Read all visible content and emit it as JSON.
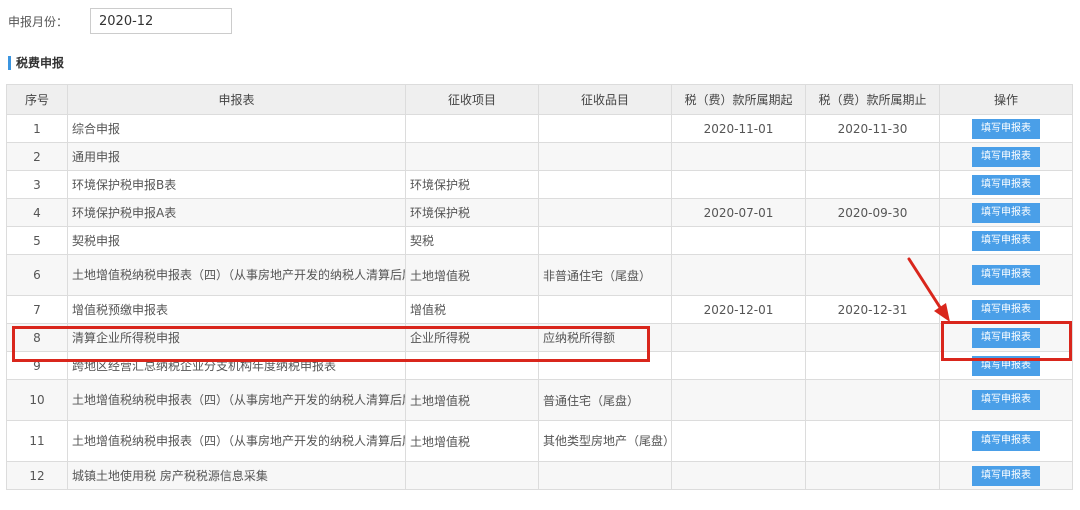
{
  "period": {
    "label": "申报月份：",
    "value": "2020-12"
  },
  "section_title": "税费申报",
  "table": {
    "headers": [
      "序号",
      "申报表",
      "征收项目",
      "征收品目",
      "税（费）款所属期起",
      "税（费）款所属期止",
      "操作"
    ],
    "button_label": "填写申报表",
    "rows": [
      {
        "no": "1",
        "form": "综合申报",
        "item": "",
        "sub": "",
        "start": "2020-11-01",
        "end": "2020-11-30"
      },
      {
        "no": "2",
        "form": "通用申报",
        "item": "",
        "sub": "",
        "start": "",
        "end": ""
      },
      {
        "no": "3",
        "form": "环境保护税申报B表",
        "item": "环境保护税",
        "sub": "",
        "start": "",
        "end": ""
      },
      {
        "no": "4",
        "form": "环境保护税申报A表",
        "item": "环境保护税",
        "sub": "",
        "start": "2020-07-01",
        "end": "2020-09-30"
      },
      {
        "no": "5",
        "form": "契税申报",
        "item": "契税",
        "sub": "",
        "start": "",
        "end": ""
      },
      {
        "no": "6",
        "form": "土地增值税纳税申报表（四）（从事房地产开发的纳税人清算后尾盘销售适用）",
        "item": "土地增值税",
        "sub": "非普通住宅（尾盘）",
        "start": "",
        "end": ""
      },
      {
        "no": "7",
        "form": "增值税预缴申报表",
        "item": "增值税",
        "sub": "",
        "start": "2020-12-01",
        "end": "2020-12-31"
      },
      {
        "no": "8",
        "form": "清算企业所得税申报",
        "item": "企业所得税",
        "sub": "应纳税所得额",
        "start": "",
        "end": ""
      },
      {
        "no": "9",
        "form": "跨地区经营汇总纳税企业分支机构年度纳税申报表",
        "item": "",
        "sub": "",
        "start": "",
        "end": ""
      },
      {
        "no": "10",
        "form": "土地增值税纳税申报表（四）（从事房地产开发的纳税人清算后尾盘销售适用）",
        "item": "土地增值税",
        "sub": "普通住宅（尾盘）",
        "start": "",
        "end": ""
      },
      {
        "no": "11",
        "form": "土地增值税纳税申报表（四）（从事房地产开发的纳税人清算后尾盘销售适用）",
        "item": "土地增值税",
        "sub": "其他类型房地产（尾盘）",
        "start": "",
        "end": ""
      },
      {
        "no": "12",
        "form": "城镇土地使用税 房产税税源信息采集",
        "item": "",
        "sub": "",
        "start": "",
        "end": ""
      }
    ]
  },
  "annotation": {
    "highlight_color": "#d9261c"
  }
}
